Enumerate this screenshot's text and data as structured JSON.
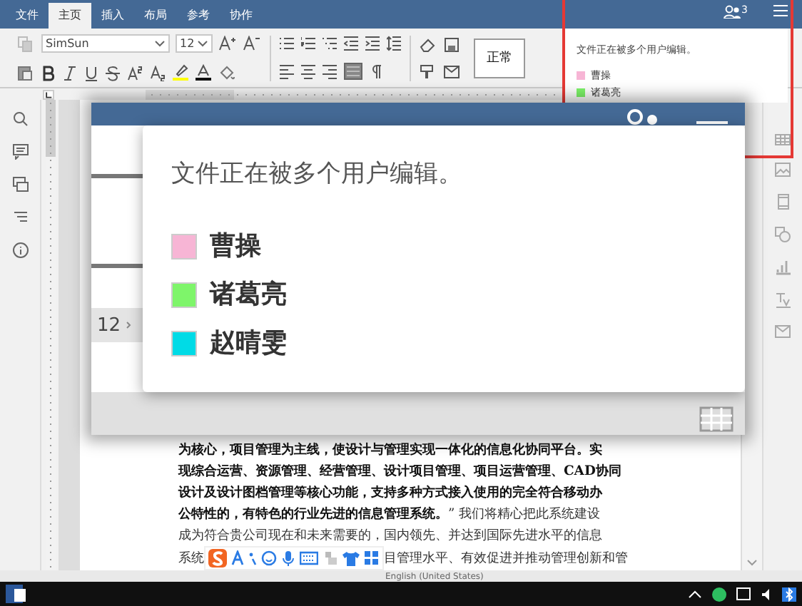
{
  "menu_tabs": [
    {
      "label": "文件",
      "selected": false
    },
    {
      "label": "主页",
      "selected": true
    },
    {
      "label": "插入",
      "selected": false
    },
    {
      "label": "布局",
      "selected": false
    },
    {
      "label": "参考",
      "selected": false
    },
    {
      "label": "协作",
      "selected": false
    }
  ],
  "collaborators": {
    "count": "3"
  },
  "toolbar": {
    "font_name": "SimSun",
    "font_size": "12",
    "style_preview": "正常"
  },
  "users_popup": {
    "message": "文件正在被多个用户编辑。",
    "users": [
      {
        "name": "曹操",
        "color": "#f7b5d5"
      },
      {
        "name": "诸葛亮",
        "color": "#7ef56a"
      }
    ]
  },
  "zoom_inset": {
    "font_size": "12",
    "users_popup": {
      "message": "文件正在被多个用户编辑。",
      "users": [
        {
          "name": "曹操",
          "color": "#f7b5d5"
        },
        {
          "name": "诸葛亮",
          "color": "#7ef56a"
        },
        {
          "name": "赵晴雯",
          "color": "#00dbe6"
        }
      ]
    }
  },
  "document": {
    "lines": [
      {
        "text": "为核心，项目管理为主线，使设计与管理实现一体化的信息化协同平台。实",
        "bold": true
      },
      {
        "text": "现综合运营、资源管理、经营管理、设计项目管理、项目运营管理、CAD协同",
        "bold": true
      },
      {
        "text": "设计及设计图档管理等核心功能，支持多种方式接入使用的完全符合移动办",
        "bold": true
      },
      {
        "text": "**公特性的，有特色的行业先进的信息管理系统。**” 我们将精心把此系统建设",
        "bold": false
      },
      {
        "text": "成为符合贵公司现在和未来需要的，国内领先、并达到国际先进水平的信息",
        "bold": false
      }
    ],
    "last_line": [
      "系统",
      "目管理水平、有效促进并推动管理创新和管"
    ]
  },
  "status_bar": {
    "language": "English (United States)"
  }
}
